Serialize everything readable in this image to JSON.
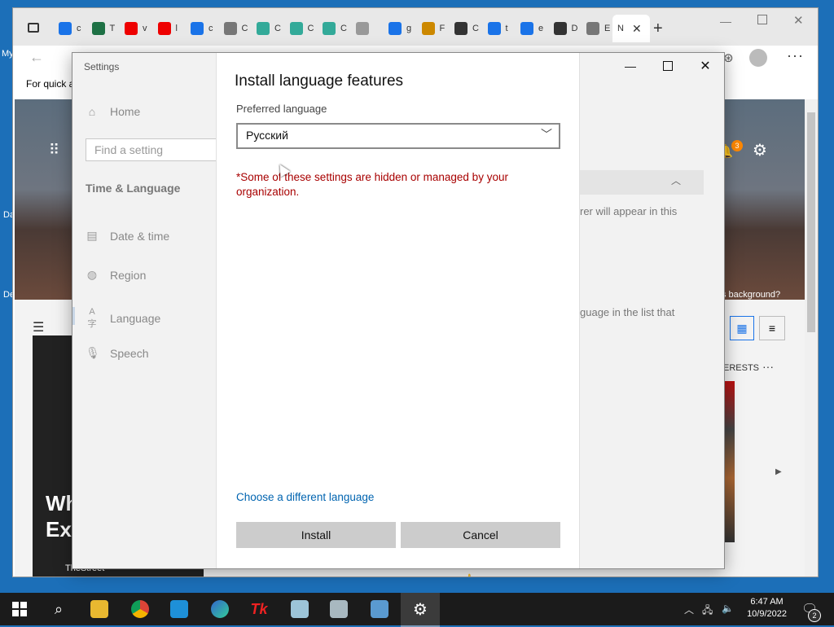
{
  "browser": {
    "tabs": [
      {
        "letter": "c",
        "color": "#1a73e8"
      },
      {
        "letter": "T",
        "color": "#1e7145"
      },
      {
        "letter": "v",
        "color": "#e00"
      },
      {
        "letter": "l",
        "color": "#e00"
      },
      {
        "letter": "c",
        "color": "#1a73e8"
      },
      {
        "letter": "C",
        "color": "#777"
      },
      {
        "letter": "C",
        "color": "#3a9"
      },
      {
        "letter": "C",
        "color": "#3a9"
      },
      {
        "letter": "C",
        "color": "#3a9"
      },
      {
        "letter": "",
        "color": "#999"
      },
      {
        "letter": "g",
        "color": "#1a73e8"
      },
      {
        "letter": "F",
        "color": "#c80"
      },
      {
        "letter": "C",
        "color": "#333"
      },
      {
        "letter": "t",
        "color": "#1a73e8"
      },
      {
        "letter": "e",
        "color": "#1a73e8"
      },
      {
        "letter": "D",
        "color": "#333"
      },
      {
        "letter": "E",
        "color": "#777"
      }
    ],
    "active_tab_letter": "N",
    "favorites_text": "For quick a",
    "page_texts": {
      "will_appear": "rer will appear in this",
      "language_in_list": "guage in the list that",
      "background_question": "s background?",
      "interests": "ERESTS",
      "notification_count": "3",
      "source": "TheStreet",
      "headline": "Wh\nEx"
    }
  },
  "desktop": {
    "icon_labels": [
      "My",
      "Da",
      "De"
    ]
  },
  "settings": {
    "window_title": "Settings",
    "nav": {
      "home": "Home",
      "search_placeholder": "Find a setting",
      "section": "Time & Language",
      "items": [
        "Date & time",
        "Region",
        "Language",
        "Speech"
      ]
    },
    "dialog": {
      "title": "Install language features",
      "preferred_label": "Preferred language",
      "selected_language": "Русский",
      "warning": "*Some of these settings are hidden or managed by your organization.",
      "choose_link": "Choose a different language",
      "install_button": "Install",
      "cancel_button": "Cancel"
    }
  },
  "taskbar": {
    "time": "6:47 AM",
    "date": "10/9/2022",
    "notification_count": "2"
  },
  "colors": {
    "warning": "#a80000",
    "link": "#0064b0",
    "taskbar": "#1b1b1b",
    "desktop": "#1c6fb8"
  }
}
